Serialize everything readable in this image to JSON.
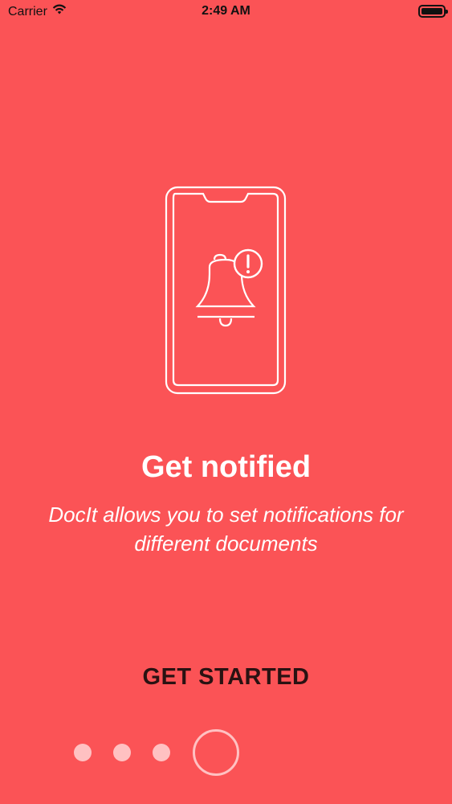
{
  "status_bar": {
    "carrier": "Carrier",
    "time": "2:49 AM"
  },
  "onboarding": {
    "illustration": "phone-with-bell-alert-icon",
    "title": "Get notified",
    "subtitle": "DocIt allows you to set notifications for different documents",
    "cta_label": "GET STARTED",
    "page_count": 4,
    "current_page": 4
  },
  "colors": {
    "background": "#fb5356",
    "text": "#ffffff",
    "cta": "#2a1212",
    "dots": "#ffc1c2"
  }
}
